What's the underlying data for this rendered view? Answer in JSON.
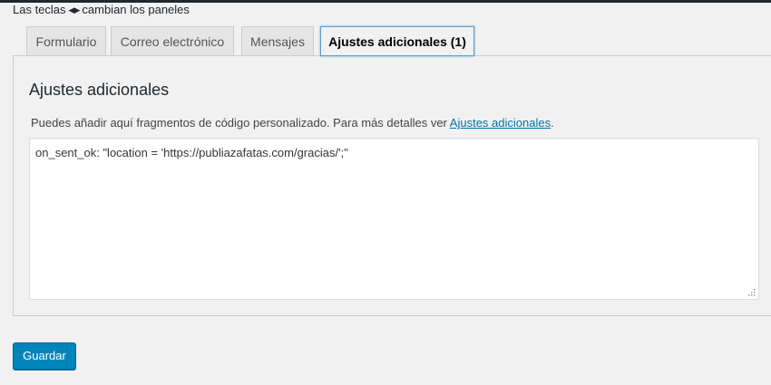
{
  "hint": {
    "prefix": "Las teclas",
    "arrows": "◀▶",
    "suffix": "cambian los paneles"
  },
  "tabs": [
    {
      "label": "Formulario",
      "active": false
    },
    {
      "label": "Correo electrónico",
      "active": false
    },
    {
      "label": "Mensajes",
      "active": false
    },
    {
      "label": "Ajustes adicionales (1)",
      "active": true
    }
  ],
  "panel": {
    "title": "Ajustes adicionales",
    "description_prefix": "Puedes añadir aquí fragmentos de código personalizado. Para más detalles ver ",
    "description_link": "Ajustes adicionales",
    "description_suffix": ".",
    "code_value": "on_sent_ok: \"location = 'https://publiazafatas.com/gracias/';\""
  },
  "actions": {
    "save_label": "Guardar"
  },
  "colors": {
    "accent": "#0085ba",
    "link": "#0073aa",
    "active_tab_border": "#5b9dd9"
  }
}
